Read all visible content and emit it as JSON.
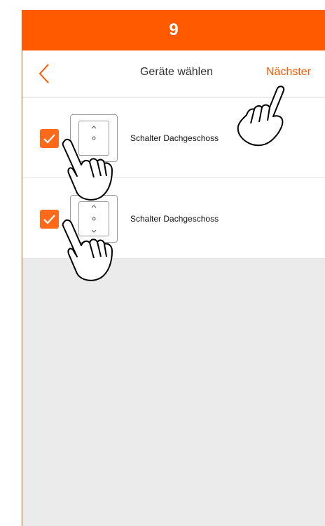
{
  "step": {
    "number": "9"
  },
  "header": {
    "back_icon": "chevron-left-icon",
    "title": "Geräte wählen",
    "next_label": "Nächster"
  },
  "devices": [
    {
      "label": "Schalter Dachgeschoss",
      "checked": true,
      "icon": "wall-switch-icon"
    },
    {
      "label": "Schalter Dachgeschoss",
      "checked": true,
      "icon": "wall-switch-icon"
    }
  ],
  "colors": {
    "accent": "#ff5a00",
    "background_empty": "#ebebeb"
  }
}
